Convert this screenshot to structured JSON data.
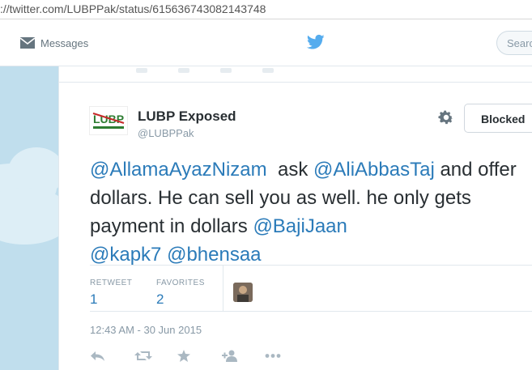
{
  "browser": {
    "url": "://twitter.com/LUBPPak/status/615636743082143748"
  },
  "topnav": {
    "messages_label": "Messages",
    "search_placeholder": "Search"
  },
  "profile": {
    "name": "LUBP Exposed",
    "handle": "@LUBPPak",
    "blocked_label": "Blocked"
  },
  "tweet": {
    "m1": "@AllamaAyazNizam",
    "t1": "  ask ",
    "m2": "@AliAbbasTaj",
    "t2": " and offer dollars. He can sell you as well. he only gets payment in dollars ",
    "m3": "@BajiJaan",
    "t3": " ",
    "m4": "@kapk7",
    "t4": " ",
    "m5": "@bhensaa"
  },
  "stats": {
    "retweets_label": "RETWEET",
    "retweets_value": "1",
    "favorites_label": "FAVORITES",
    "favorites_value": "2"
  },
  "timestamp": "12:43 AM - 30 Jun 2015",
  "colors": {
    "link": "#2b7bb9",
    "background": "#c0deed",
    "text": "#292f33",
    "muted": "#8899a6",
    "twitter_blue": "#55acee"
  },
  "icons": [
    "envelope-icon",
    "twitter-bird-icon",
    "gear-icon",
    "reply-icon",
    "retweet-icon",
    "favorite-icon",
    "follow-icon",
    "more-icon"
  ]
}
